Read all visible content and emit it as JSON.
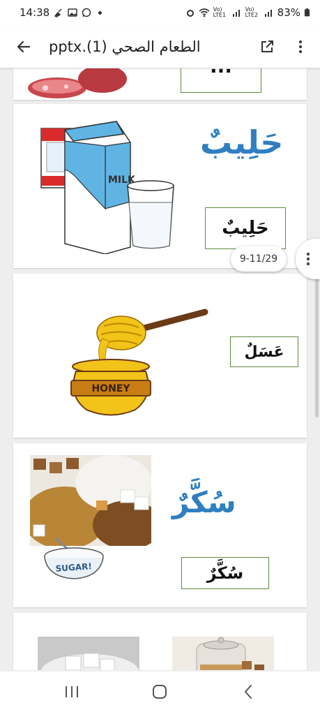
{
  "status_bar": {
    "time": "14:38",
    "network_label_1": "Vo) LTE1",
    "network_label_2": "Vo) LTE2",
    "battery": "83%"
  },
  "app_bar": {
    "title": "pptx.(1) الطعام الصحي",
    "back_icon": "arrow-left-icon",
    "open_external_icon": "open-in-new-icon",
    "more_icon": "more-vertical-icon"
  },
  "slides": [
    {
      "word_box": "..."
    },
    {
      "big_word": "حَلِيبٌ",
      "word_box": "حَلِيبٌ",
      "image_label": "MILK"
    },
    {
      "word_box": "عَسَلٌ",
      "image_label": "HONEY"
    },
    {
      "big_word": "سُكَّرٌ",
      "word_box": "سُكَّرٌ",
      "image_label": "SUGAR!"
    },
    {}
  ],
  "page_indicator": "9-11/29",
  "nav_bar": {
    "recents_icon": "recents-icon",
    "home_icon": "home-icon",
    "back_icon": "nav-back-icon"
  }
}
